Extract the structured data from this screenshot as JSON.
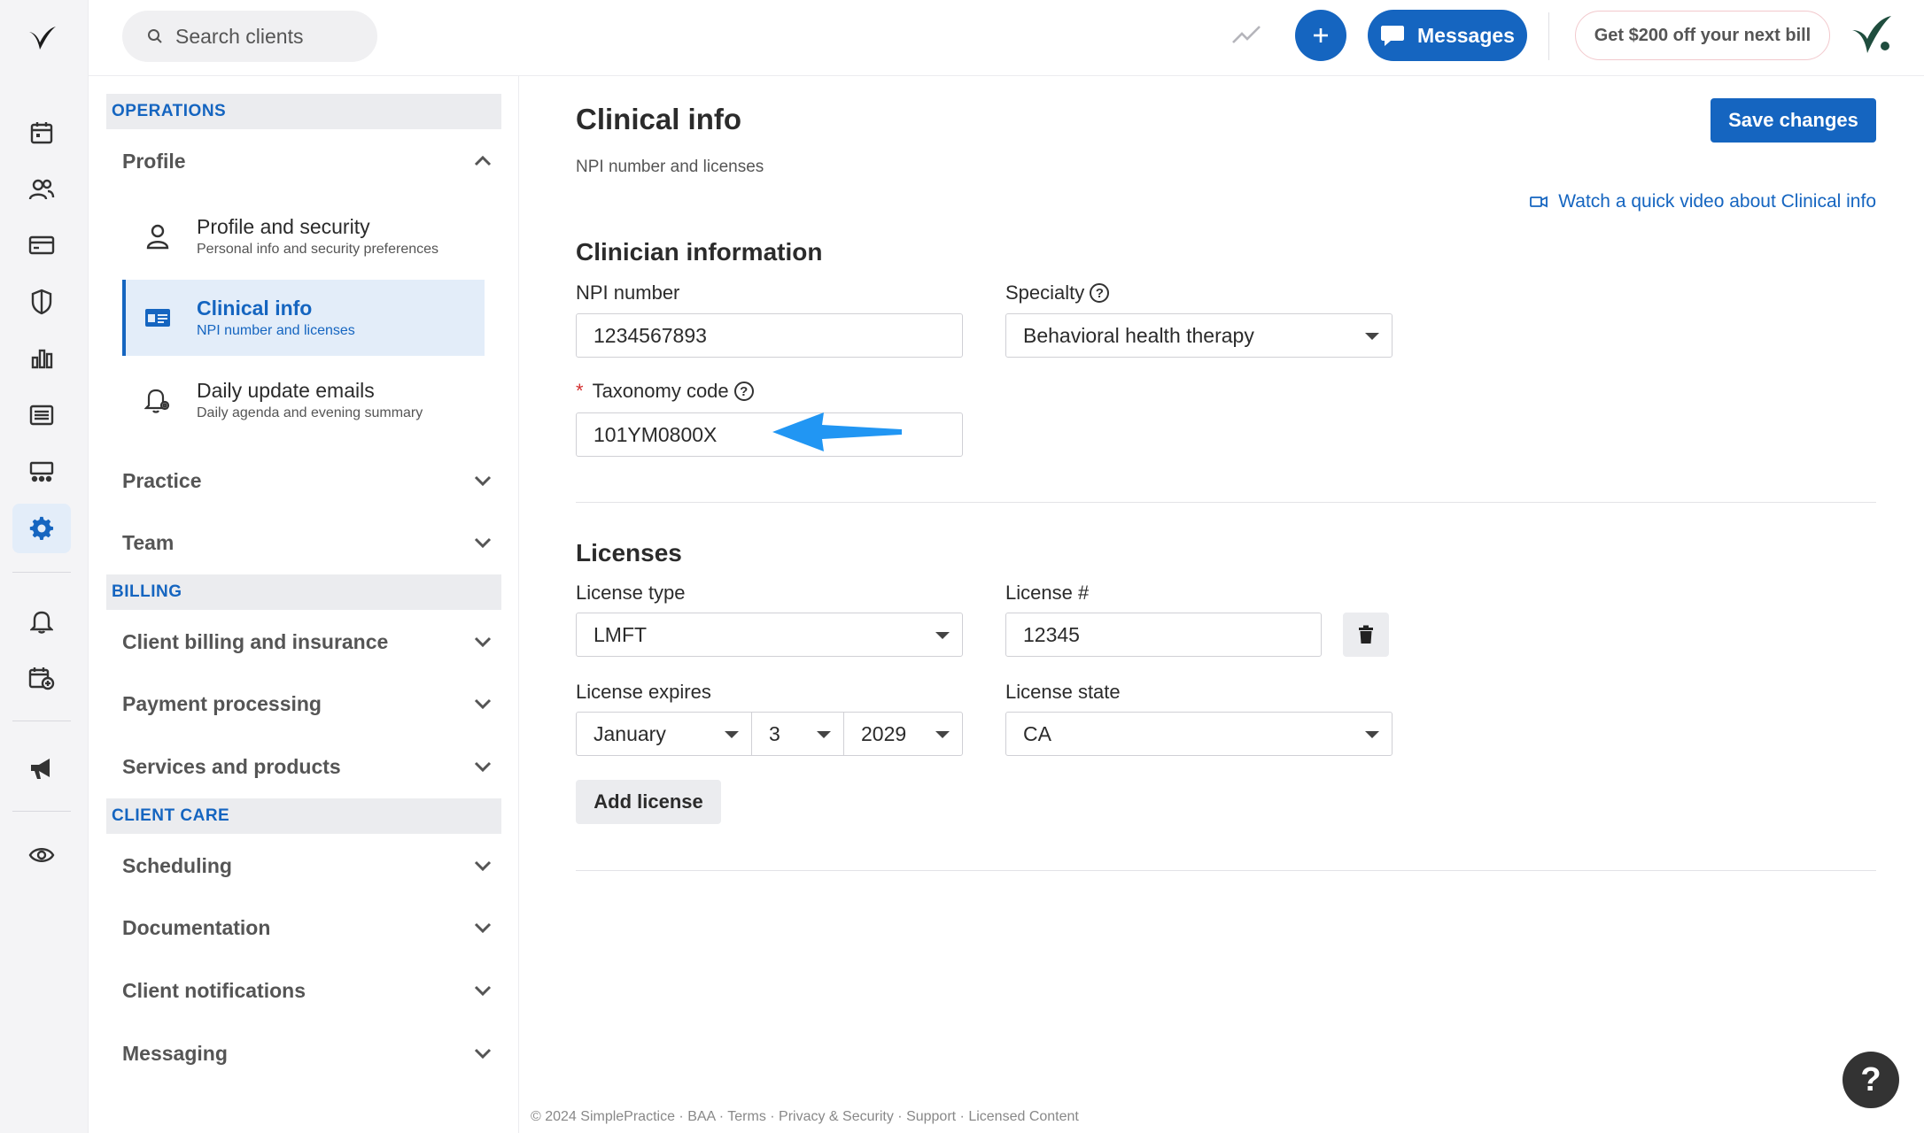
{
  "header": {
    "search_placeholder": "Search clients",
    "messages_label": "Messages",
    "promo_label": "Get $200 off your next bill"
  },
  "rail": {
    "icons": [
      "logo-icon",
      "calendar-icon",
      "clients-icon",
      "billing-icon",
      "shield-icon",
      "analytics-icon",
      "list-icon",
      "activity-icon",
      "settings-icon",
      "bell-icon",
      "calendar-add-icon",
      "megaphone-icon",
      "eye-icon"
    ],
    "active": "settings-icon"
  },
  "nav": {
    "operations": {
      "heading": "OPERATIONS",
      "profile_label": "Profile",
      "profile_items": [
        {
          "title": "Profile and security",
          "subtitle": "Personal info and security preferences"
        },
        {
          "title": "Clinical info",
          "subtitle": "NPI number and licenses"
        },
        {
          "title": "Daily update emails",
          "subtitle": "Daily agenda and evening summary"
        }
      ],
      "practice_label": "Practice",
      "team_label": "Team"
    },
    "billing": {
      "heading": "BILLING",
      "items": [
        "Client billing and insurance",
        "Payment processing",
        "Services and products"
      ]
    },
    "client_care": {
      "heading": "CLIENT CARE",
      "items": [
        "Scheduling",
        "Documentation",
        "Client notifications",
        "Messaging"
      ]
    }
  },
  "main": {
    "title": "Clinical info",
    "subtitle": "NPI number and licenses",
    "save_label": "Save changes",
    "video_link": "Watch a quick video about Clinical info",
    "clinician": {
      "heading": "Clinician information",
      "npi_label": "NPI number",
      "npi_value": "1234567893",
      "specialty_label": "Specialty",
      "specialty_value": "Behavioral health therapy",
      "taxonomy_required": "*",
      "taxonomy_label": "Taxonomy code",
      "taxonomy_value": "101YM0800X"
    },
    "licenses": {
      "heading": "Licenses",
      "type_label": "License type",
      "type_value": "LMFT",
      "number_label": "License #",
      "number_value": "12345",
      "expires_label": "License expires",
      "expires_month": "January",
      "expires_day": "3",
      "expires_year": "2029",
      "state_label": "License state",
      "state_value": "CA",
      "add_label": "Add license"
    },
    "footer": "© 2024 SimplePractice · BAA · Terms · Privacy & Security · Support · Licensed Content",
    "help_glyph": "?"
  },
  "colors": {
    "accent": "#1565c0",
    "annotation_arrow": "#2196f3",
    "required": "#d32f2f"
  }
}
